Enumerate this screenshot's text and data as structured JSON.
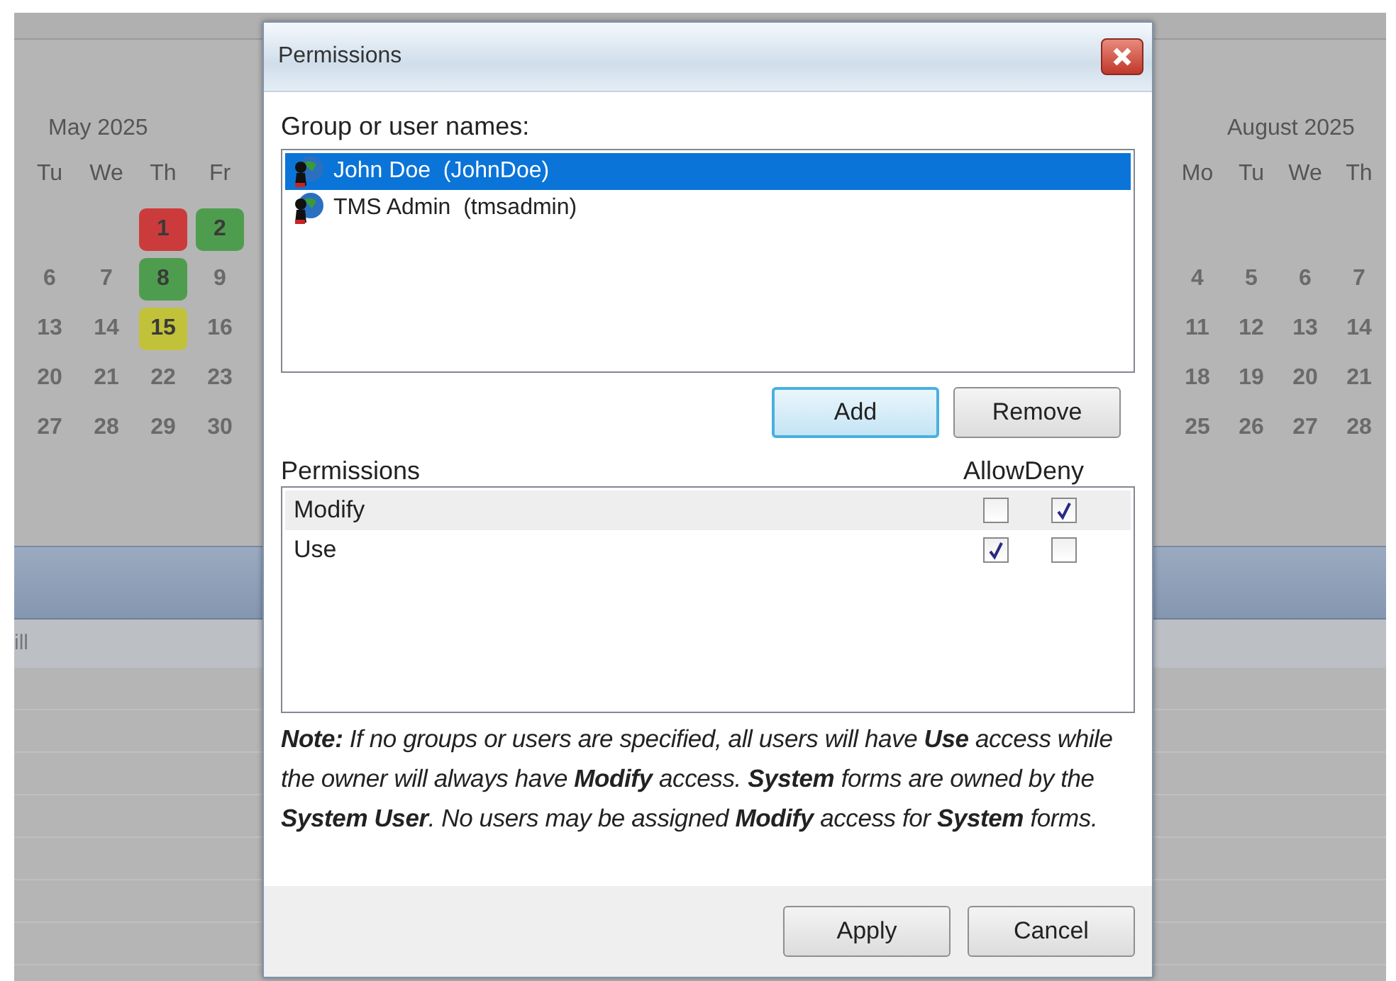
{
  "background": {
    "calendars": [
      {
        "month": "May 2025",
        "weekdays": [
          "Tu",
          "We",
          "Th",
          "Fr"
        ],
        "weeks": [
          [
            {
              "day": "1",
              "color": "#cc3b3b"
            },
            {
              "day": "2",
              "color": "#4e9d4e"
            }
          ],
          [
            {
              "day": "6"
            },
            {
              "day": "7"
            },
            {
              "day": "8",
              "color": "#4e9d4e"
            },
            {
              "day": "9"
            }
          ],
          [
            {
              "day": "13"
            },
            {
              "day": "14"
            },
            {
              "day": "15",
              "color": "#c2c23a"
            },
            {
              "day": "16"
            }
          ],
          [
            {
              "day": "20"
            },
            {
              "day": "21"
            },
            {
              "day": "22"
            },
            {
              "day": "23"
            }
          ],
          [
            {
              "day": "27"
            },
            {
              "day": "28"
            },
            {
              "day": "29"
            },
            {
              "day": "30"
            }
          ]
        ]
      },
      {
        "month": "August 2025",
        "weekdays": [
          "Mo",
          "Tu",
          "We",
          "Th"
        ],
        "weeks": [
          [
            {
              "day": "4"
            },
            {
              "day": "5"
            },
            {
              "day": "6"
            },
            {
              "day": "7"
            }
          ],
          [
            {
              "day": "11"
            },
            {
              "day": "12"
            },
            {
              "day": "13"
            },
            {
              "day": "14"
            }
          ],
          [
            {
              "day": "18"
            },
            {
              "day": "19"
            },
            {
              "day": "20"
            },
            {
              "day": "21"
            }
          ],
          [
            {
              "day": "25"
            },
            {
              "day": "26"
            },
            {
              "day": "27"
            },
            {
              "day": "28"
            }
          ]
        ]
      }
    ],
    "grid_header": "ill"
  },
  "dialog": {
    "title": "Permissions",
    "users_label": "Group or user names:",
    "users": [
      {
        "name": "John Doe",
        "login": "(JohnDoe)",
        "selected": true
      },
      {
        "name": "TMS Admin",
        "login": "(tmsadmin)",
        "selected": false
      }
    ],
    "user_buttons": [
      {
        "label": "Add",
        "focused": true
      },
      {
        "label": "Remove",
        "focused": false
      }
    ],
    "permissions_label": "Permissions",
    "columns": [
      "Allow",
      "Deny"
    ],
    "permissions": [
      {
        "name": "Modify",
        "selected": true,
        "allow": false,
        "deny": true
      },
      {
        "name": "Use",
        "selected": false,
        "allow": true,
        "deny": false
      }
    ],
    "note": "**Note:** If no groups or users are specified, all users will have **Use** access while the owner will always have **Modify** access. **System** forms are owned by the **System User**. No users may be assigned **Modify** access for **System** forms.",
    "buttons": [
      "Apply",
      "Cancel"
    ]
  }
}
